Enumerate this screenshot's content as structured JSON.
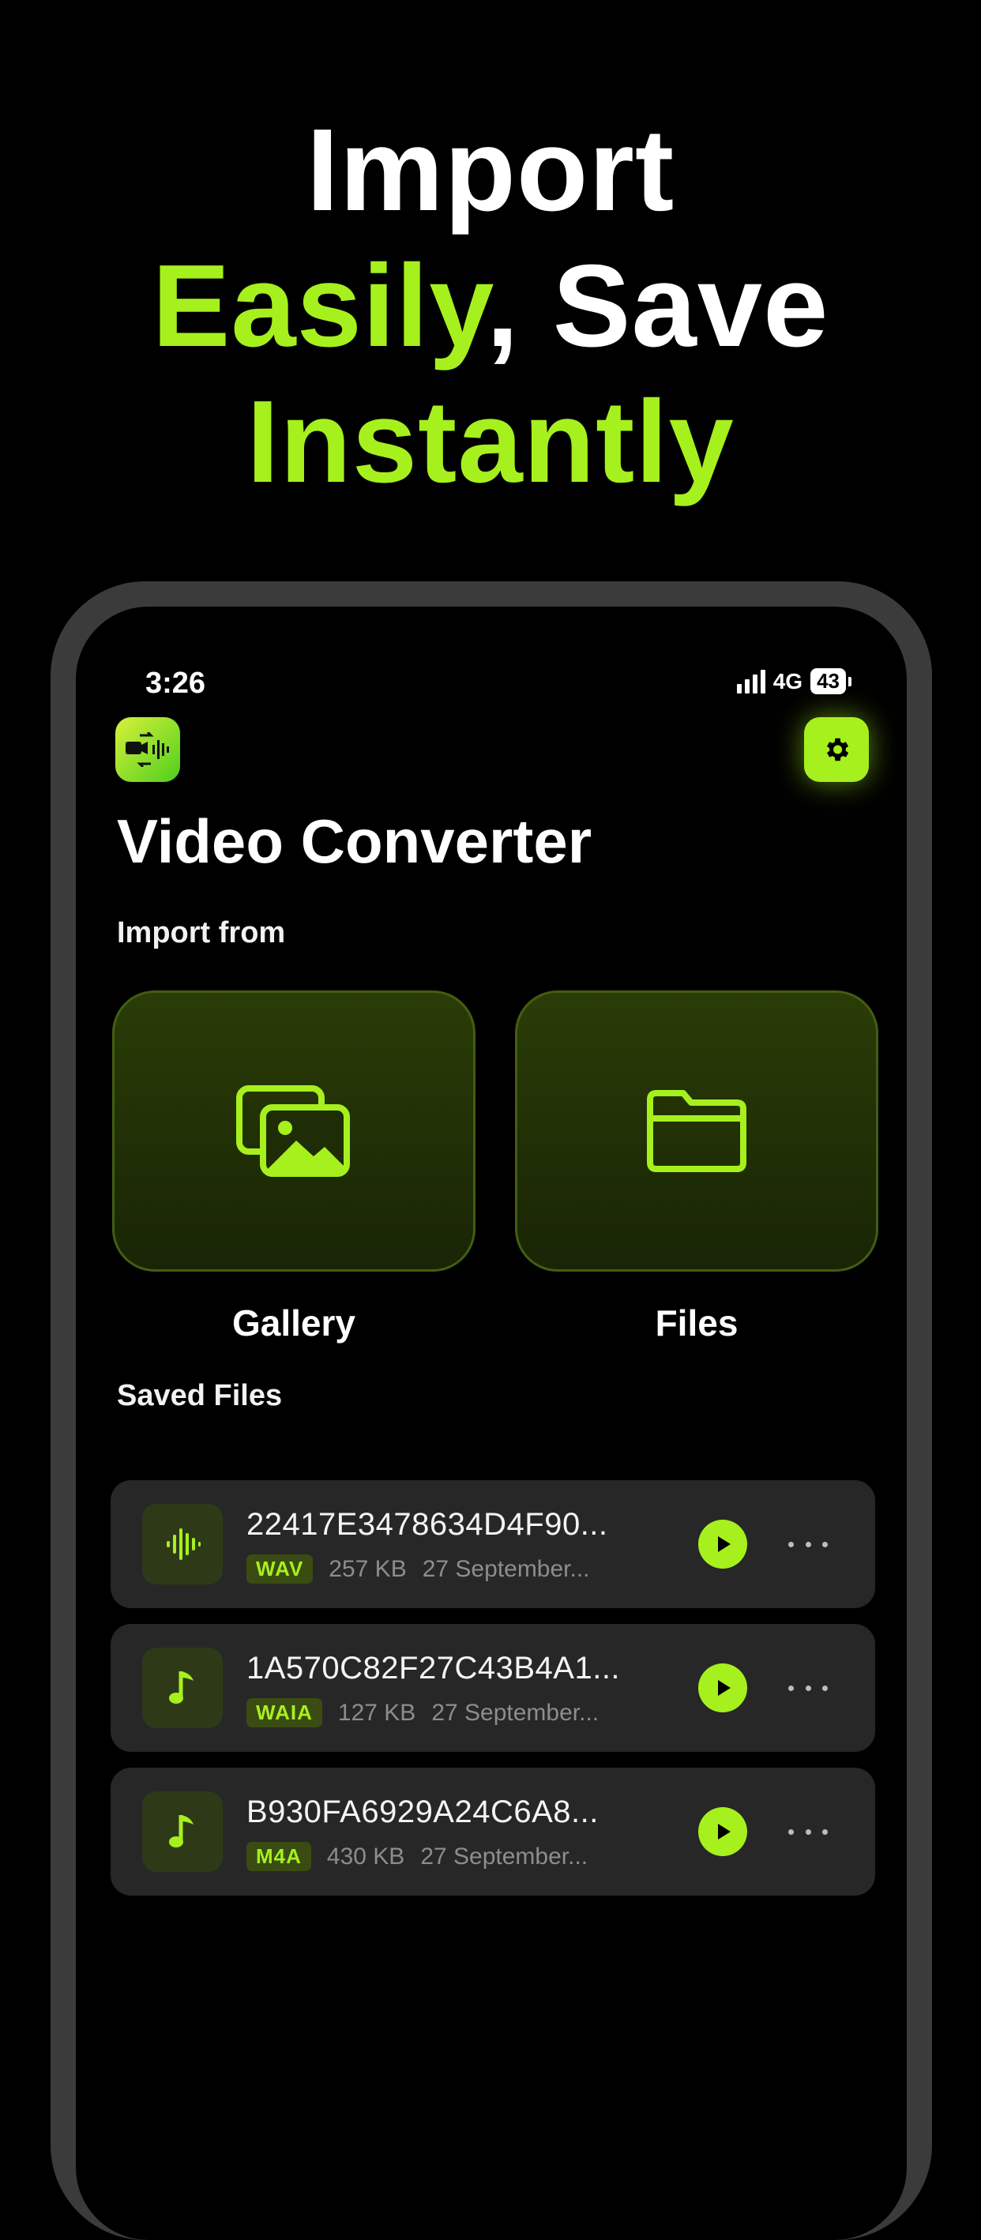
{
  "headline": {
    "line1": "Import",
    "line2_green": "Easily",
    "line2_white": ", Save",
    "line3": "Instantly"
  },
  "status_bar": {
    "time": "3:26",
    "network": "4G",
    "battery": "43"
  },
  "app": {
    "title": "Video Converter",
    "logo_icon": "video-to-audio-icon",
    "settings_icon": "gear-icon"
  },
  "import": {
    "label": "Import from",
    "sources": [
      {
        "label": "Gallery",
        "icon": "gallery-icon"
      },
      {
        "label": "Files",
        "icon": "folder-icon"
      }
    ]
  },
  "saved_files": {
    "label": "Saved Files",
    "items": [
      {
        "name": "22417E3478634D4F90...",
        "format": "WAV",
        "size": "257 KB",
        "date": "27 September...",
        "icon": "waveform-icon"
      },
      {
        "name": "1A570C82F27C43B4A1...",
        "format": "WAIA",
        "size": "127 KB",
        "date": "27 September...",
        "icon": "music-note-icon"
      },
      {
        "name": "B930FA6929A24C6A8...",
        "format": "M4A",
        "size": "430 KB",
        "date": "27 September...",
        "icon": "music-note-icon"
      }
    ]
  },
  "colors": {
    "accent": "#a6f01e",
    "background": "#000000",
    "card": "#272727"
  }
}
